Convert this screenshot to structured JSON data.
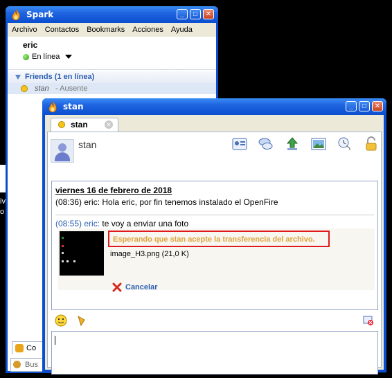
{
  "main_window": {
    "title": "Spark",
    "menu": [
      "Archivo",
      "Contactos",
      "Bookmarks",
      "Acciones",
      "Ayuda"
    ],
    "user_name": "eric",
    "status": "En línea",
    "group_label": "Friends (1 en línea)",
    "contact": {
      "name": "stan",
      "status": " - Ausente"
    },
    "bottom_tab_fragment": "Co",
    "bottom_search_fragment": "Bus"
  },
  "left_fragments": [
    "iv",
    "o"
  ],
  "chat_window": {
    "title": "stan",
    "tab_label": "stan",
    "contact_name": "stan",
    "transcript": {
      "date_header": "viernes 16 de febrero de 2018",
      "message1": "(08:36) eric: Hola eric, por fin tenemos instalado el OpenFire",
      "message2_time_user": "(08:55) eric:",
      "message2_text": " te voy a enviar una foto"
    },
    "transfer": {
      "status": "Esperando que stan acepte la transferencia del archivo.",
      "file_name": "image_H3.png (21,0 K)",
      "cancel_label": "Cancelar"
    }
  }
}
